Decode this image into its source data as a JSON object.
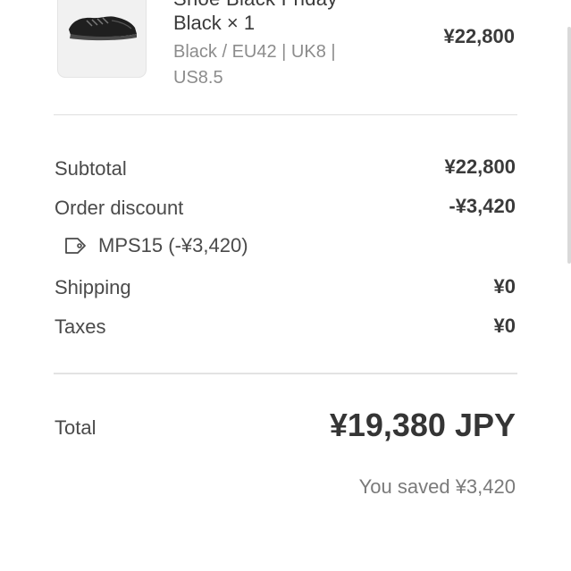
{
  "line_item": {
    "title_top_cut": "Shoe Black Friday",
    "variant_qty": "Black × 1",
    "variant_detail": "Black / EU42 | UK8 | US8.5",
    "price": "¥22,800"
  },
  "summary": {
    "subtotal_label": "Subtotal",
    "subtotal_value": "¥22,800",
    "discount_label": "Order discount",
    "discount_value": "-¥3,420",
    "discount_code": "MPS15 (-¥3,420)",
    "shipping_label": "Shipping",
    "shipping_value": "¥0",
    "taxes_label": "Taxes",
    "taxes_value": "¥0"
  },
  "total": {
    "label": "Total",
    "value": "¥19,380 JPY",
    "savings": "You saved ¥3,420"
  },
  "icons": {
    "product": "shoe-thumbnail",
    "discount": "tag-icon"
  }
}
